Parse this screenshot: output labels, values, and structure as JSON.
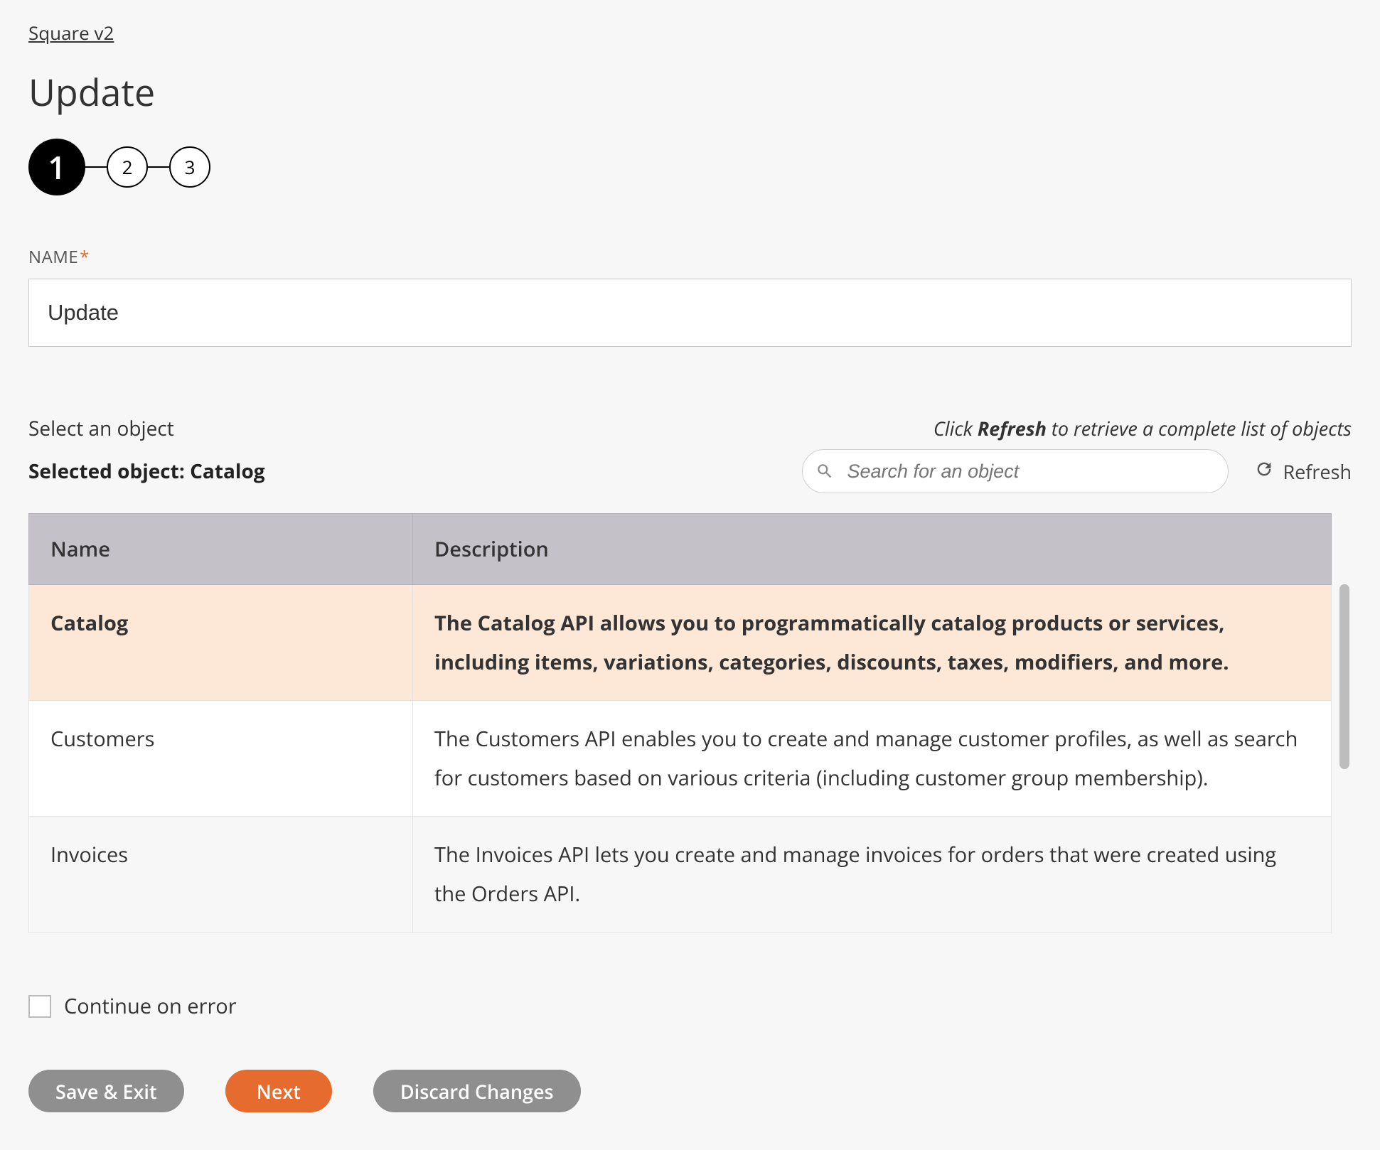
{
  "breadcrumb": "Square v2",
  "page_title": "Update",
  "stepper": {
    "steps": [
      "1",
      "2",
      "3"
    ],
    "active_index": 0
  },
  "name_field": {
    "label": "NAME",
    "required_mark": "*",
    "value": "Update"
  },
  "object_section": {
    "select_label": "Select an object",
    "hint_prefix": "Click ",
    "hint_bold": "Refresh",
    "hint_suffix": " to retrieve a complete list of objects",
    "selected_prefix": "Selected object: ",
    "selected_value": "Catalog",
    "search_placeholder": "Search for an object",
    "refresh_label": "Refresh"
  },
  "table": {
    "columns": {
      "name": "Name",
      "description": "Description"
    },
    "selected_name": "Catalog",
    "rows": [
      {
        "name": "Catalog",
        "description": "The Catalog API allows you to programmatically catalog products or services, including items, variations, categories, discounts, taxes, modifiers, and more."
      },
      {
        "name": "Customers",
        "description": "The Customers API enables you to create and manage customer profiles, as well as search for customers based on various criteria (including customer group membership)."
      },
      {
        "name": "Invoices",
        "description": "The Invoices API lets you create and manage invoices for orders that were created using the Orders API."
      }
    ]
  },
  "continue_on_error": {
    "label": "Continue on error",
    "checked": false
  },
  "buttons": {
    "save_exit": "Save & Exit",
    "next": "Next",
    "discard": "Discard Changes"
  }
}
